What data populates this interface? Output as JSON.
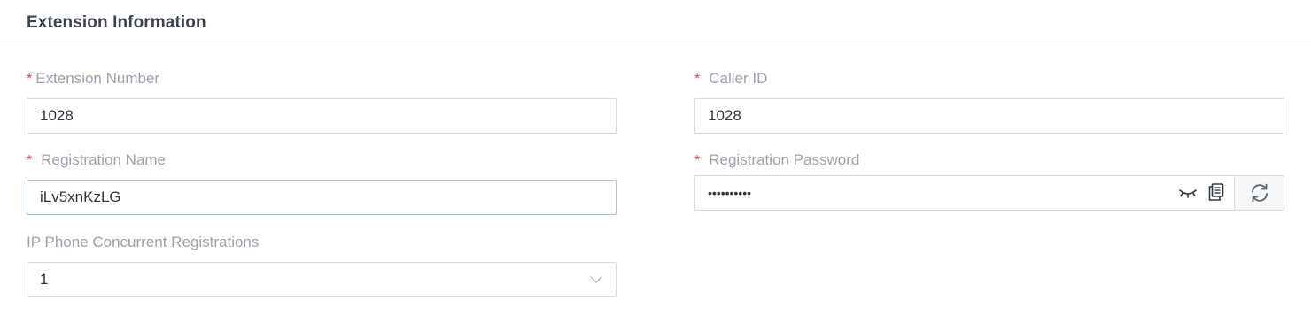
{
  "section": {
    "title": "Extension Information"
  },
  "fields": {
    "extension_number": {
      "required_mark": "*",
      "label": "Extension Number",
      "value": "1028"
    },
    "caller_id": {
      "required_mark": "*",
      "label": "Caller ID",
      "value": "1028"
    },
    "registration_name": {
      "required_mark": "*",
      "label": "Registration Name",
      "value": "iLv5xnKzLG"
    },
    "registration_password": {
      "required_mark": "*",
      "label": "Registration Password",
      "value": "••••••••••",
      "icons": [
        "eye-closed-icon",
        "copy-icon",
        "refresh-icon"
      ]
    },
    "concurrent_registrations": {
      "label": "IP Phone Concurrent Registrations",
      "value": "1",
      "icon": "chevron-down-icon"
    }
  },
  "colors": {
    "required": "#e0404f",
    "label": "#9aa1ad",
    "text": "#2f3540",
    "border": "#d6d9df",
    "focus_border": "#a3c4d6"
  }
}
